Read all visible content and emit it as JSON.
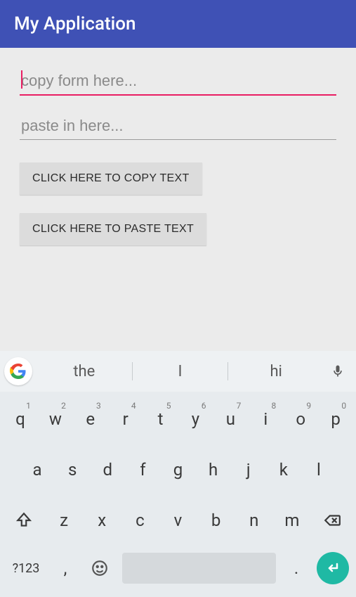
{
  "appbar": {
    "title": "My Application"
  },
  "inputs": {
    "copy": {
      "placeholder": "copy form here...",
      "value": ""
    },
    "paste": {
      "placeholder": "paste in here...",
      "value": ""
    }
  },
  "buttons": {
    "copy": "CLICK HERE TO COPY TEXT",
    "paste": "CLICK HERE TO PASTE TEXT"
  },
  "keyboard": {
    "suggestions": [
      "the",
      "I",
      "hi"
    ],
    "row1": [
      {
        "k": "q",
        "n": "1"
      },
      {
        "k": "w",
        "n": "2"
      },
      {
        "k": "e",
        "n": "3"
      },
      {
        "k": "r",
        "n": "4"
      },
      {
        "k": "t",
        "n": "5"
      },
      {
        "k": "y",
        "n": "6"
      },
      {
        "k": "u",
        "n": "7"
      },
      {
        "k": "i",
        "n": "8"
      },
      {
        "k": "o",
        "n": "9"
      },
      {
        "k": "p",
        "n": "0"
      }
    ],
    "row2": [
      "a",
      "s",
      "d",
      "f",
      "g",
      "h",
      "j",
      "k",
      "l"
    ],
    "row3": [
      "z",
      "x",
      "c",
      "v",
      "b",
      "n",
      "m"
    ],
    "bottom": {
      "symbols": "?123",
      "comma": ",",
      "dot": "."
    }
  }
}
